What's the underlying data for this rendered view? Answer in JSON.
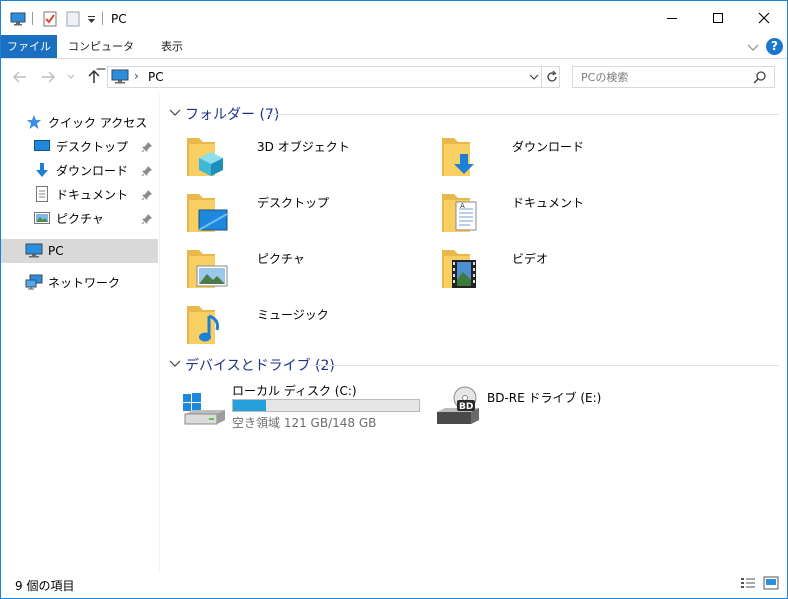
{
  "window": {
    "title": "PC"
  },
  "quick_access_toolbar": {
    "icons": [
      "computer-icon",
      "properties-check-icon",
      "new-folder-icon",
      "customize-dropdown-icon"
    ]
  },
  "ribbon": {
    "tabs": [
      {
        "label": "ファイル",
        "active": true
      },
      {
        "label": "コンピューター",
        "active": false
      },
      {
        "label": "表示",
        "active": false
      }
    ],
    "help": "?"
  },
  "address_bar": {
    "path": "PC",
    "separator": "›"
  },
  "search": {
    "placeholder": "PCの検索"
  },
  "nav_pane": {
    "quick_access": "クイック アクセス",
    "quick_items": [
      {
        "label": "デスクトップ",
        "icon": "desktop-icon",
        "pinned": true
      },
      {
        "label": "ダウンロード",
        "icon": "download-arrow-icon",
        "pinned": true
      },
      {
        "label": "ドキュメント",
        "icon": "document-icon",
        "pinned": true
      },
      {
        "label": "ピクチャ",
        "icon": "picture-icon",
        "pinned": true
      }
    ],
    "pc": "PC",
    "network": "ネットワーク"
  },
  "folders": {
    "header": "フォルダー (7)",
    "items": [
      {
        "label": "3D オブジェクト",
        "icon": "3d-objects-folder-icon"
      },
      {
        "label": "ダウンロード",
        "icon": "downloads-folder-icon"
      },
      {
        "label": "デスクトップ",
        "icon": "desktop-folder-icon"
      },
      {
        "label": "ドキュメント",
        "icon": "documents-folder-icon"
      },
      {
        "label": "ピクチャ",
        "icon": "pictures-folder-icon"
      },
      {
        "label": "ビデオ",
        "icon": "videos-folder-icon"
      },
      {
        "label": "ミュージック",
        "icon": "music-folder-icon"
      }
    ]
  },
  "devices": {
    "header": "デバイスとドライブ (2)",
    "items": [
      {
        "label": "ローカル ディスク (C:)",
        "free": "空き領域 121 GB/148 GB",
        "used_fraction": 0.18,
        "icon": "windows-drive-icon"
      },
      {
        "label": "BD-RE ドライブ (E:)",
        "icon": "bd-drive-icon",
        "badge": "BD"
      }
    ]
  },
  "status_bar": {
    "count": "9 個の項目"
  },
  "colors": {
    "accent": "#1a6fc0",
    "group_header": "#1e3287",
    "progress": "#26a0da",
    "folder_yellow": "#f7cf62"
  }
}
